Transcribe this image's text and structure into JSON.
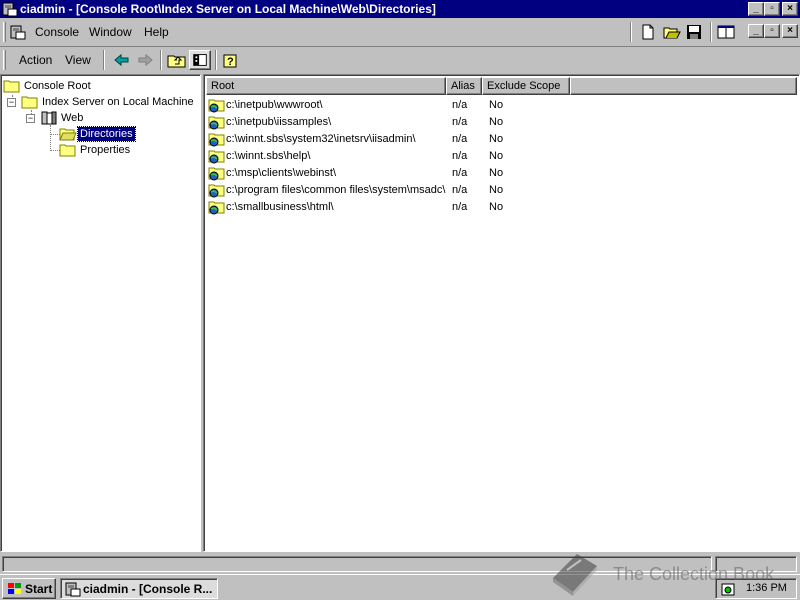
{
  "window": {
    "title": "ciadmin - [Console Root\\Index Server on Local Machine\\Web\\Directories]",
    "caption_buttons": [
      "minimize",
      "maximize",
      "close"
    ]
  },
  "menubar": {
    "items": [
      {
        "label": "Console"
      },
      {
        "label": "Window"
      },
      {
        "label": "Help"
      }
    ]
  },
  "toolbar": {
    "action_label": "Action",
    "view_label": "View"
  },
  "tree": {
    "nodes": [
      {
        "label": "Console Root",
        "icon": "folder-icon",
        "expander": ""
      },
      {
        "label": "Index Server on Local Machine",
        "icon": "folder-icon",
        "expander": "−"
      },
      {
        "label": "Web",
        "icon": "catalog-icon",
        "expander": "−"
      },
      {
        "label": "Directories",
        "icon": "folder-open-icon",
        "selected": true
      },
      {
        "label": "Properties",
        "icon": "folder-icon"
      }
    ]
  },
  "list": {
    "columns": [
      "Root",
      "Alias",
      "Exclude Scope"
    ],
    "rows": [
      {
        "root": "c:\\inetpub\\wwwroot\\",
        "alias": "n/a",
        "exclude": "No"
      },
      {
        "root": "c:\\inetpub\\iissamples\\",
        "alias": "n/a",
        "exclude": "No"
      },
      {
        "root": "c:\\winnt.sbs\\system32\\inetsrv\\iisadmin\\",
        "alias": "n/a",
        "exclude": "No"
      },
      {
        "root": "c:\\winnt.sbs\\help\\",
        "alias": "n/a",
        "exclude": "No"
      },
      {
        "root": "c:\\msp\\clients\\webinst\\",
        "alias": "n/a",
        "exclude": "No"
      },
      {
        "root": "c:\\program files\\common files\\system\\msadc\\",
        "alias": "n/a",
        "exclude": "No"
      },
      {
        "root": "c:\\smallbusiness\\html\\",
        "alias": "n/a",
        "exclude": "No"
      }
    ]
  },
  "taskbar": {
    "start_label": "Start",
    "task_label": "ciadmin - [Console R...",
    "clock": "1:36 PM"
  },
  "watermark": {
    "text": "The Collection Book"
  },
  "colors": {
    "titlebar": "#000080",
    "face": "#c0c0c0",
    "selection": "#000080",
    "folder": "#ffff80"
  }
}
